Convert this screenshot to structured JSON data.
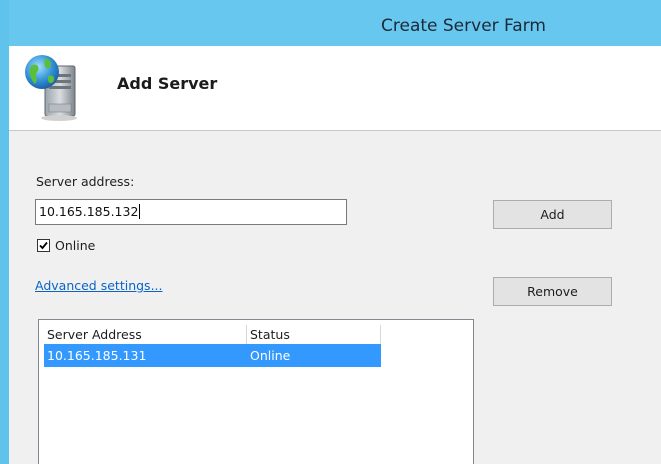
{
  "window": {
    "title": "Create Server Farm"
  },
  "header": {
    "title": "Add Server",
    "icon": "server-globe-icon"
  },
  "form": {
    "server_address_label": "Server address:",
    "server_address_value": "10.165.185.132",
    "online_label": "Online",
    "online_checked": true,
    "advanced_link": "Advanced settings..."
  },
  "buttons": {
    "add": "Add",
    "remove": "Remove"
  },
  "server_list": {
    "columns": [
      "Server Address",
      "Status"
    ],
    "rows": [
      {
        "address": "10.165.185.131",
        "status": "Online",
        "selected": true
      }
    ]
  },
  "colors": {
    "titlebar": "#68c7ef",
    "selection": "#3399ff",
    "link": "#0a64c8",
    "body_bg": "#f0f0f0"
  }
}
